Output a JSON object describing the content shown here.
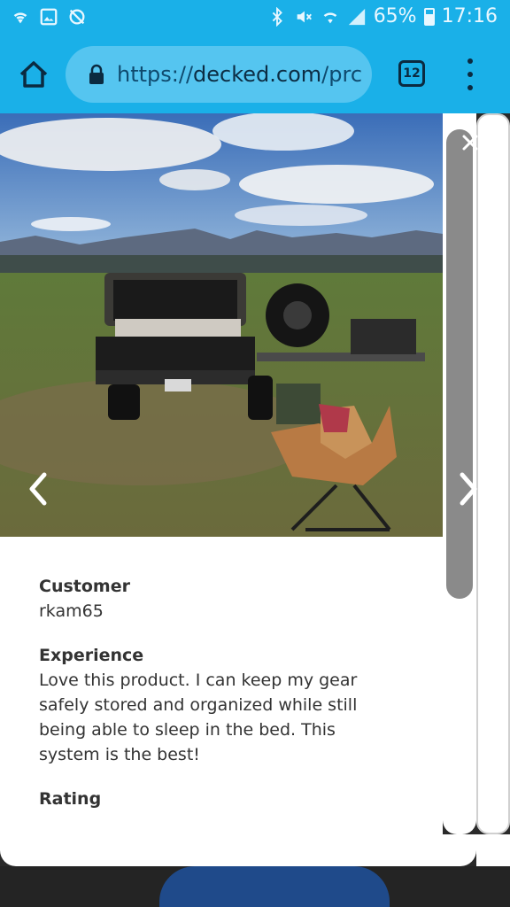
{
  "status_bar": {
    "battery_percent": "65%",
    "time": "17:16"
  },
  "browser": {
    "url_scheme": "https://",
    "url_host": "decked.com",
    "url_path": "/prc",
    "tab_count": "12"
  },
  "review": {
    "customer_label": "Customer",
    "customer_value": "rkam65",
    "experience_label": "Experience",
    "experience_value": "Love this product. I can keep my gear safely stored and organized while still being able to sleep in the bed. This system is the best!",
    "rating_label": "Rating"
  },
  "colors": {
    "chrome_blue": "#1ab0e8",
    "url_pill": "#55c5f0"
  }
}
